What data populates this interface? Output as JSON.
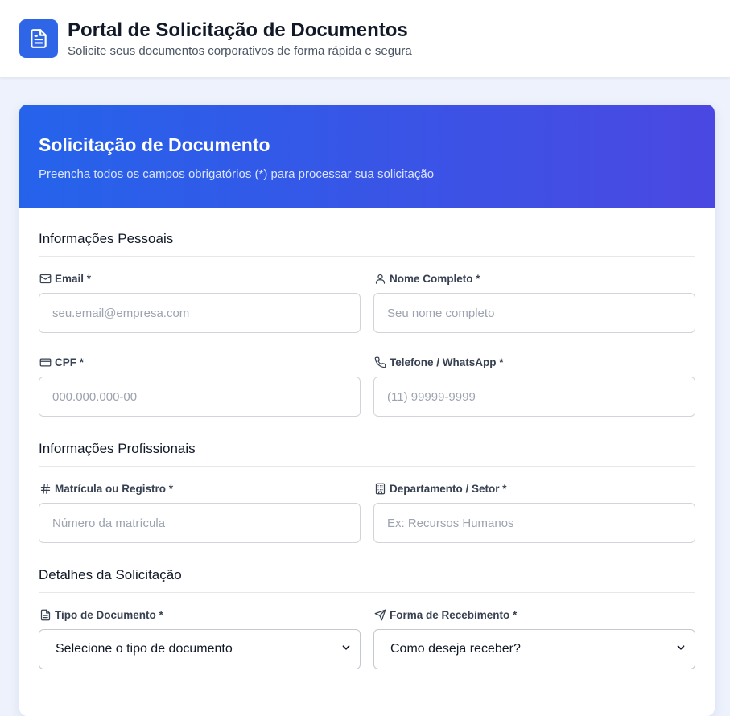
{
  "header": {
    "title": "Portal de Solicitação de Documentos",
    "subtitle": "Solicite seus documentos corporativos de forma rápida e segura",
    "logo_icon": "document-icon"
  },
  "form": {
    "title": "Solicitação de Documento",
    "subtitle": "Preencha todos os campos obrigatórios (*) para processar sua solicitação",
    "sections": {
      "personal": {
        "title": "Informações Pessoais",
        "email": {
          "label": "Email *",
          "placeholder": "seu.email@empresa.com",
          "icon": "mail-icon"
        },
        "name": {
          "label": "Nome Completo *",
          "placeholder": "Seu nome completo",
          "icon": "user-icon"
        },
        "cpf": {
          "label": "CPF *",
          "placeholder": "000.000.000-00",
          "icon": "card-icon"
        },
        "phone": {
          "label": "Telefone / WhatsApp *",
          "placeholder": "(11) 99999-9999",
          "icon": "phone-icon"
        }
      },
      "professional": {
        "title": "Informações Profissionais",
        "registration": {
          "label": "Matrícula ou Registro *",
          "placeholder": "Número da matrícula",
          "icon": "hash-icon"
        },
        "department": {
          "label": "Departamento / Setor *",
          "placeholder": "Ex: Recursos Humanos",
          "icon": "building-icon"
        }
      },
      "details": {
        "title": "Detalhes da Solicitação",
        "doc_type": {
          "label": "Tipo de Documento *",
          "selected": "Selecione o tipo de documento",
          "icon": "file-icon"
        },
        "delivery": {
          "label": "Forma de Recebimento *",
          "selected": "Como deseja receber?",
          "icon": "send-icon"
        }
      }
    }
  },
  "colors": {
    "brand": "#2f66e8",
    "gradient_start": "#2563eb",
    "gradient_end": "#4a48e2",
    "page_bg": "#eef2fc"
  }
}
